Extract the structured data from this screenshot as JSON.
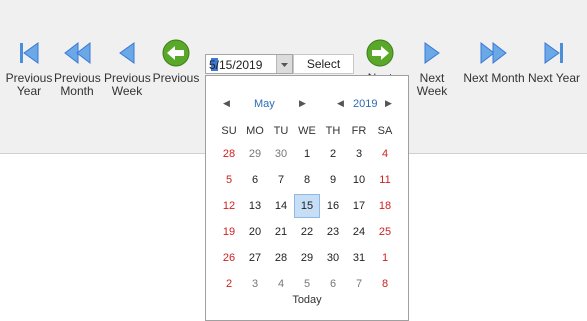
{
  "toolbar": {
    "buttons": [
      {
        "label": "Previous\nYear",
        "icon": "first-page-icon"
      },
      {
        "label": "Previous\nMonth",
        "icon": "double-left-icon"
      },
      {
        "label": "Previous\nWeek",
        "icon": "left-triangle-icon"
      },
      {
        "label": "Previous",
        "icon": "green-left-arrow-icon"
      },
      {
        "label": "Next",
        "icon": "green-right-arrow-icon"
      },
      {
        "label": "Next Week",
        "icon": "right-triangle-icon"
      },
      {
        "label": "Next Month",
        "icon": "double-right-icon"
      },
      {
        "label": "Next Year",
        "icon": "last-page-icon"
      }
    ],
    "date_value": "5/15/2019",
    "select_date_label": "Select Date"
  },
  "calendar": {
    "month": "May",
    "year": "2019",
    "weekdays": [
      "SU",
      "MO",
      "TU",
      "WE",
      "TH",
      "FR",
      "SA"
    ],
    "weeks": [
      [
        "28",
        "29",
        "30",
        "1",
        "2",
        "3",
        "4"
      ],
      [
        "5",
        "6",
        "7",
        "8",
        "9",
        "10",
        "11"
      ],
      [
        "12",
        "13",
        "14",
        "15",
        "16",
        "17",
        "18"
      ],
      [
        "19",
        "20",
        "21",
        "22",
        "23",
        "24",
        "25"
      ],
      [
        "26",
        "27",
        "28",
        "29",
        "30",
        "31",
        "1"
      ],
      [
        "2",
        "3",
        "4",
        "5",
        "6",
        "7",
        "8"
      ]
    ],
    "selected_day": "15",
    "today_label": "Today"
  },
  "colors": {
    "accent": "#2b6cb5",
    "weekend": "#d02020",
    "selected_bg": "#c7dff6",
    "nav_icon_blue": "#4a8fd8",
    "nav_icon_green": "#5aa82a"
  }
}
